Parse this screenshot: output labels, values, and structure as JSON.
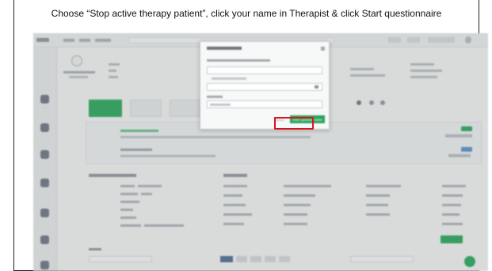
{
  "instruction": "Choose “Stop active therapy patient”, click your name in Therapist & click Start questionnaire",
  "modal": {
    "title": "Start questionnaire",
    "primary_label": "Start questionnaire",
    "cancel_label": "Cancel"
  },
  "colors": {
    "highlight": "#d9141b",
    "primary_green": "#2aa45b"
  }
}
